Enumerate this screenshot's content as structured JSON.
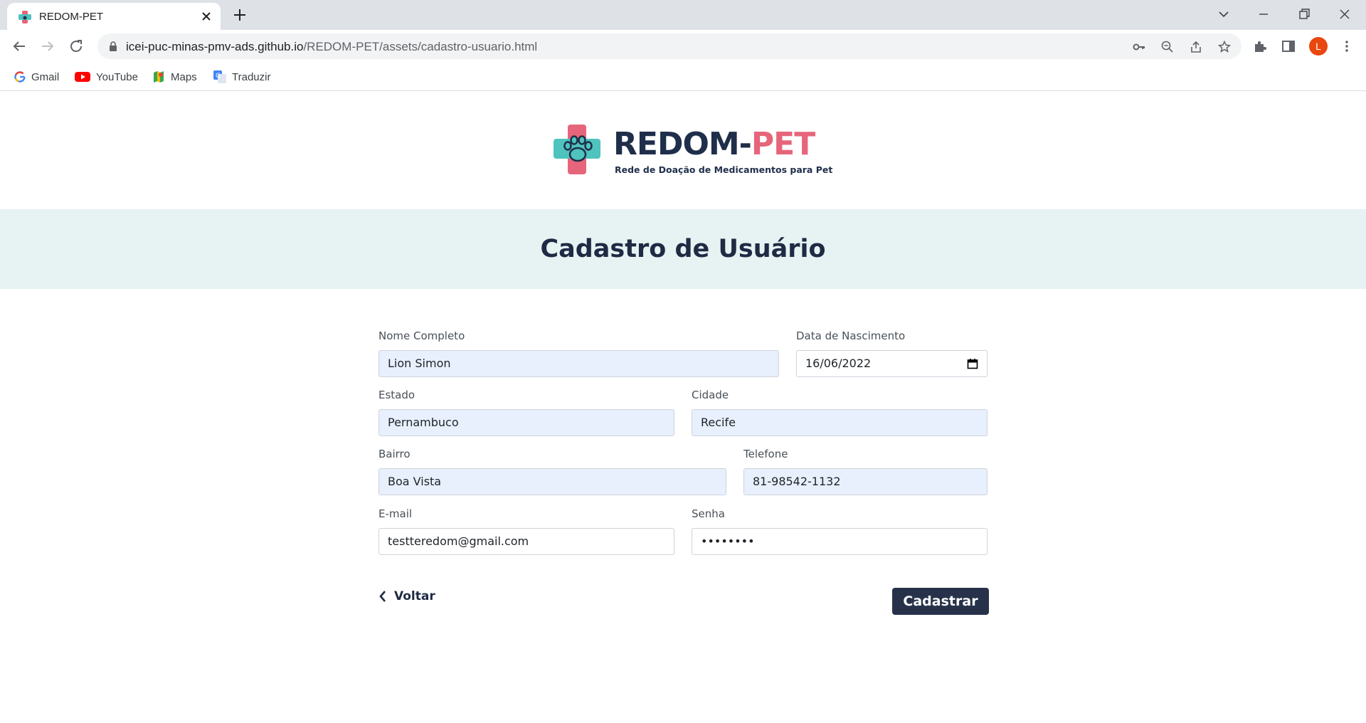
{
  "browser": {
    "tab_title": "REDOM-PET",
    "url_host": "icei-puc-minas-pmv-ads.github.io",
    "url_path": "/REDOM-PET/assets/cadastro-usuario.html",
    "profile_initial": "L",
    "bookmarks": [
      {
        "label": "Gmail",
        "icon": "google-icon"
      },
      {
        "label": "YouTube",
        "icon": "youtube-icon"
      },
      {
        "label": "Maps",
        "icon": "maps-icon"
      },
      {
        "label": "Traduzir",
        "icon": "translate-icon"
      }
    ]
  },
  "logo": {
    "name_part1": "REDOM-",
    "name_part2": "PET",
    "tagline": "Rede de Doação de Medicamentos para Pet"
  },
  "page": {
    "title": "Cadastro de Usuário"
  },
  "form": {
    "nome": {
      "label": "Nome Completo",
      "value": "Lion Simon"
    },
    "nascimento": {
      "label": "Data de Nascimento",
      "value": "16/06/2022"
    },
    "estado": {
      "label": "Estado",
      "value": "Pernambuco"
    },
    "cidade": {
      "label": "Cidade",
      "value": "Recife"
    },
    "bairro": {
      "label": "Bairro",
      "value": "Boa Vista"
    },
    "telefone": {
      "label": "Telefone",
      "value": "81-98542-1132"
    },
    "email": {
      "label": "E-mail",
      "value": "testteredom@gmail.com"
    },
    "senha": {
      "label": "Senha",
      "value": "••••••••"
    },
    "back_label": "Voltar",
    "submit_label": "Cadastrar"
  },
  "colors": {
    "brand_dark": "#1f2e4a",
    "brand_pink": "#e6657a",
    "brand_teal": "#4fc3bd",
    "banner_bg": "#e6f3f2",
    "autofill_bg": "#e8f0fe",
    "button_bg": "#27324a"
  }
}
